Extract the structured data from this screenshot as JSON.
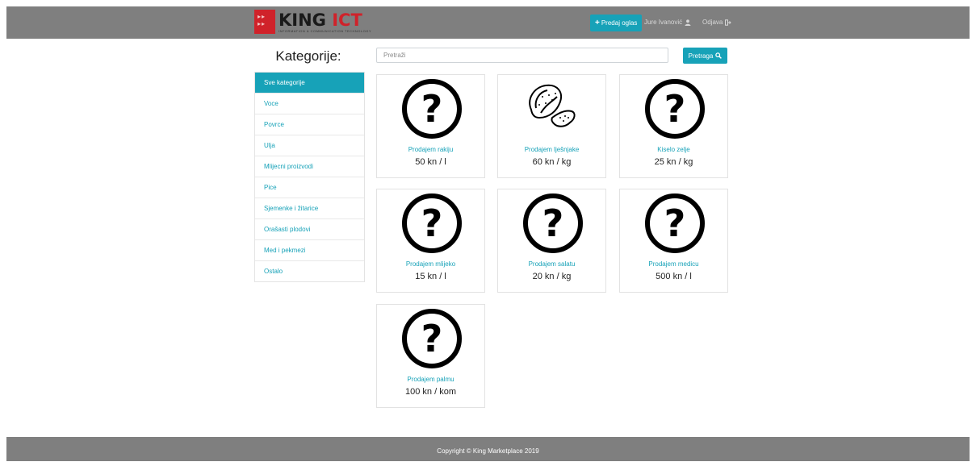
{
  "header": {
    "logo_title_black": "KING",
    "logo_title_red": "ICT",
    "logo_subtitle": "INFORMATION & COMMUNICATION TECHNOLOGY",
    "logo_box_text": "▸▸ ▸▸",
    "sell_button_label": "Predaj oglas",
    "sell_button_icon": "+",
    "user_name": "Jure Ivanović",
    "user_icon": "👤",
    "logout_label": "Odjava",
    "logout_icon": "⇥"
  },
  "sidebar": {
    "heading": "Kategorije:",
    "items": [
      {
        "label": "Sve kategorije"
      },
      {
        "label": "Voce"
      },
      {
        "label": "Povrce"
      },
      {
        "label": "Ulja"
      },
      {
        "label": "Mlijecni proizvodi"
      },
      {
        "label": "Pice"
      },
      {
        "label": "Sjemenke i žitarice"
      },
      {
        "label": "Orašasti plodovi"
      },
      {
        "label": "Med i pekmezi"
      },
      {
        "label": "Ostalo"
      }
    ]
  },
  "search": {
    "placeholder": "Pretraži",
    "button_label": "Pretraga"
  },
  "listings": [
    {
      "title": "Prodajem rakiju",
      "price": "50 kn / l",
      "image": "question-mark-icon"
    },
    {
      "title": "Prodajem lješnjake",
      "price": "60 kn / kg",
      "image": "hazelnut-icon"
    },
    {
      "title": "Kiselo zelje",
      "price": "25 kn / kg",
      "image": "question-mark-icon"
    },
    {
      "title": "Prodajem mlijeko",
      "price": "15 kn / l",
      "image": "question-mark-icon"
    },
    {
      "title": "Prodajem salatu",
      "price": "20 kn / kg",
      "image": "question-mark-icon"
    },
    {
      "title": "Prodajem medicu",
      "price": "500 kn / l",
      "image": "question-mark-icon"
    },
    {
      "title": "Prodajem palmu",
      "price": "100 kn / kom",
      "image": "question-mark-icon"
    }
  ],
  "footer": {
    "copyright": "Copyright © King Marketplace 2019"
  },
  "colors": {
    "accent": "#17a2b8",
    "header_bg": "#7f7f7f",
    "brand_red": "#d0222a"
  }
}
